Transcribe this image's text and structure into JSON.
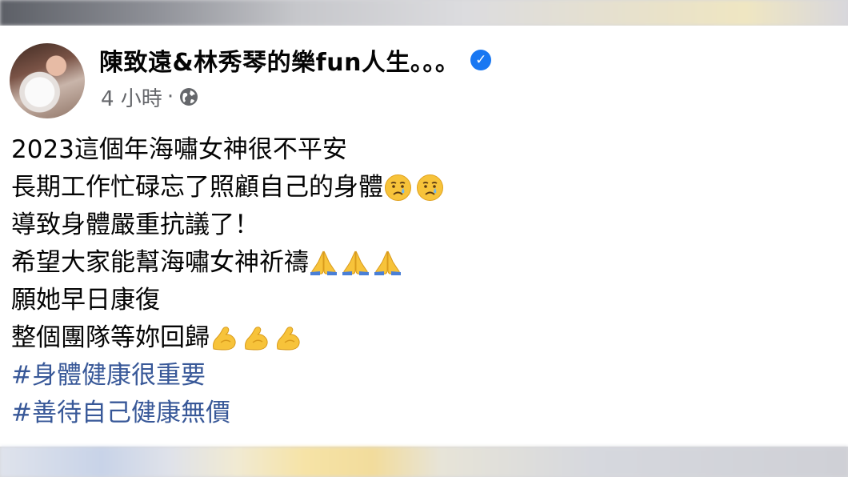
{
  "post": {
    "page_name": "陳致遠&林秀琴的樂fun人生。。。",
    "verified_icon": "verified-badge-icon",
    "timestamp": "4 小時",
    "separator": "·",
    "audience_icon": "globe-icon",
    "lines": [
      {
        "text": "2023這個年海嘯女神很不平安",
        "emojis": []
      },
      {
        "text": "長期工作忙碌忘了照顧自己的身體",
        "emojis": [
          "sad-tear-face-icon",
          "sad-tear-face-icon"
        ]
      },
      {
        "text": "導致身體嚴重抗議了！",
        "emojis": []
      },
      {
        "text": "希望大家能幫海嘯女神祈禱",
        "emojis": [
          "folded-hands-icon",
          "folded-hands-icon",
          "folded-hands-icon"
        ]
      },
      {
        "text": "願她早日康復",
        "emojis": []
      },
      {
        "text": "整個團隊等妳回歸",
        "emojis": [
          "flexed-biceps-icon",
          "flexed-biceps-icon",
          "flexed-biceps-icon"
        ]
      }
    ],
    "hashtags": [
      "#身體健康很重要",
      "#善待自己健康無價"
    ]
  },
  "colors": {
    "hashtag": "#385898",
    "verified": "#1877f2",
    "meta_text": "#65676b"
  }
}
